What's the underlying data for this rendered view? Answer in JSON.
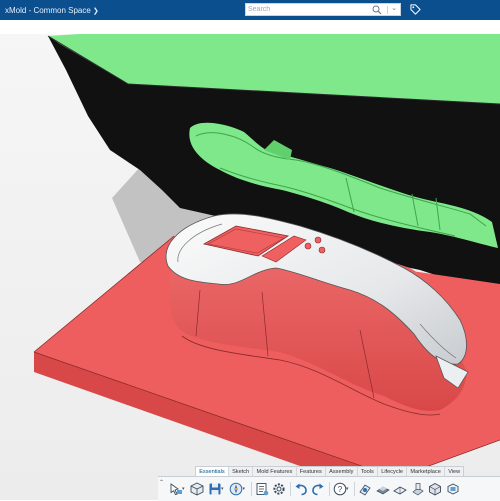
{
  "app": {
    "title": "xMold - Common Space",
    "title_chevron": "chevron-down-icon"
  },
  "search": {
    "placeholder": "Search",
    "value": ""
  },
  "header_icons": [
    "search-icon",
    "chevron-down-icon",
    "tag-icon"
  ],
  "action_bar": {
    "tabs": [
      {
        "label": "Essentials",
        "active": true
      },
      {
        "label": "Sketch",
        "active": false
      },
      {
        "label": "Mold Features",
        "active": false
      },
      {
        "label": "Features",
        "active": false
      },
      {
        "label": "Assembly",
        "active": false
      },
      {
        "label": "Tools",
        "active": false
      },
      {
        "label": "Lifecycle",
        "active": false
      },
      {
        "label": "Marketplace",
        "active": false
      },
      {
        "label": "View",
        "active": false
      }
    ],
    "tools": [
      "select-icon",
      "new-part-icon",
      "save-icon",
      "compass-icon",
      "properties-icon",
      "settings-icon",
      "undo-icon",
      "redo-icon",
      "help-icon",
      "measure-icon",
      "shaded-view-icon",
      "edge-view-icon",
      "section-view-icon",
      "box-view-icon",
      "fit-view-icon"
    ]
  },
  "colors": {
    "header": "#0b4f8f",
    "cavity_green": "#7ee88a",
    "core_red": "#ee5e5e",
    "part_white": "#eceff1",
    "cavity_black": "#111111"
  }
}
